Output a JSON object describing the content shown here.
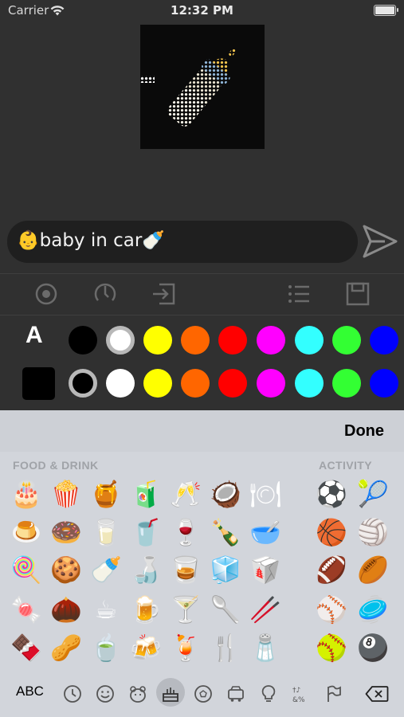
{
  "status_bar": {
    "carrier": "Carrier",
    "time": "12:32 PM"
  },
  "preview": {
    "description_icon": "baby-bottle-dot-matrix"
  },
  "message": {
    "text": "👶baby in car🍼"
  },
  "toolbar": {
    "icons": [
      "record-icon",
      "speed-icon",
      "import-icon",
      "list-icon",
      "save-icon"
    ]
  },
  "palette": {
    "text_label": "A",
    "text_colors": [
      "#000000",
      "#ffffff",
      "#ffff00",
      "#ff6600",
      "#ff0000",
      "#ff00ff",
      "#33ffff",
      "#33ff33",
      "#0000ff"
    ],
    "bg_colors": [
      "#000000",
      "#ffffff",
      "#ffff00",
      "#ff6600",
      "#ff0000",
      "#ff00ff",
      "#33ffff",
      "#33ff33",
      "#0000ff"
    ]
  },
  "keyboard": {
    "done_label": "Done",
    "section_food": "FOOD & DRINK",
    "section_activity": "ACTIVITY",
    "food_rows": [
      [
        "🎂",
        "🍿",
        "🍯",
        "🧃",
        "🥂",
        "🥥",
        "🍽"
      ],
      [
        "🍮",
        "🍩",
        "🥛",
        "🥤",
        "🍷",
        "🍾",
        "🥣"
      ],
      [
        "🍭",
        "🍪",
        "🍼",
        "🍶",
        "🥃",
        "🧊",
        "🥡"
      ],
      [
        "🍬",
        "🌰",
        "☕",
        "🍺",
        "🍸",
        "🥄",
        "🥢"
      ],
      [
        "🍫",
        "🥜",
        "🍵",
        "🍻",
        "🍹",
        "🍴",
        "🧂"
      ]
    ],
    "activity_rows": [
      [
        "⚽",
        "🎾"
      ],
      [
        "🏀",
        "🏐"
      ],
      [
        "🏈",
        "🏉"
      ],
      [
        "⚾",
        "🥏"
      ],
      [
        "🥎",
        "🎱"
      ]
    ],
    "abc_label": "ABC",
    "categories": [
      "recent-icon",
      "smiley-icon",
      "animal-icon",
      "food-icon",
      "activity-icon",
      "travel-icon",
      "objects-icon",
      "symbols-icon",
      "flag-icon"
    ]
  }
}
